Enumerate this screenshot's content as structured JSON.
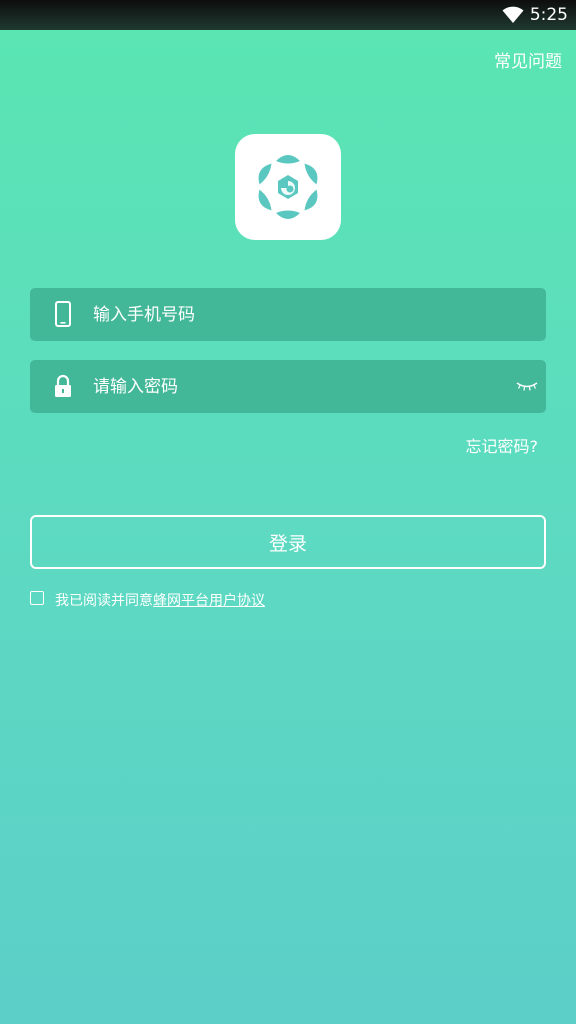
{
  "status_bar": {
    "time": "5:25",
    "wifi_icon": "wifi-icon"
  },
  "header": {
    "faq_label": "常见问题"
  },
  "logo": {
    "icon": "flower-logo-icon"
  },
  "phone_field": {
    "placeholder": "输入手机号码",
    "icon": "phone-icon"
  },
  "password_field": {
    "placeholder": "请输入密码",
    "icon": "lock-icon",
    "toggle_icon": "eye-closed-icon"
  },
  "forgot_label": "忘记密码?",
  "login_label": "登录",
  "agreement": {
    "prefix": "我已阅读并同意",
    "link": "蜂网平台用户协议",
    "checked": false
  },
  "colors": {
    "background_top": "#5ae6b2",
    "background_bottom": "#5ccfc8",
    "field_bg": "#43b898",
    "logo_accent": "#5ac8c0"
  }
}
